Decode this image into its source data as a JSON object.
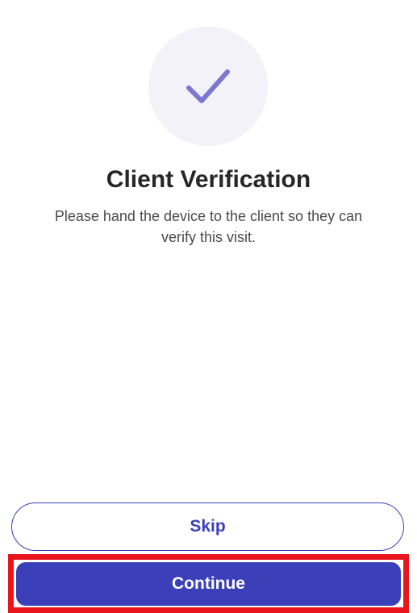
{
  "screen": {
    "icon": "checkmark-icon",
    "title": "Client Verification",
    "description": "Please hand the device to the client so they can verify this visit."
  },
  "actions": {
    "skip_label": "Skip",
    "continue_label": "Continue"
  },
  "colors": {
    "accent": "#3b40b8",
    "icon_circle_bg": "#f2f2f8",
    "checkmark": "#7b79cf",
    "highlight": "#e8151d"
  }
}
